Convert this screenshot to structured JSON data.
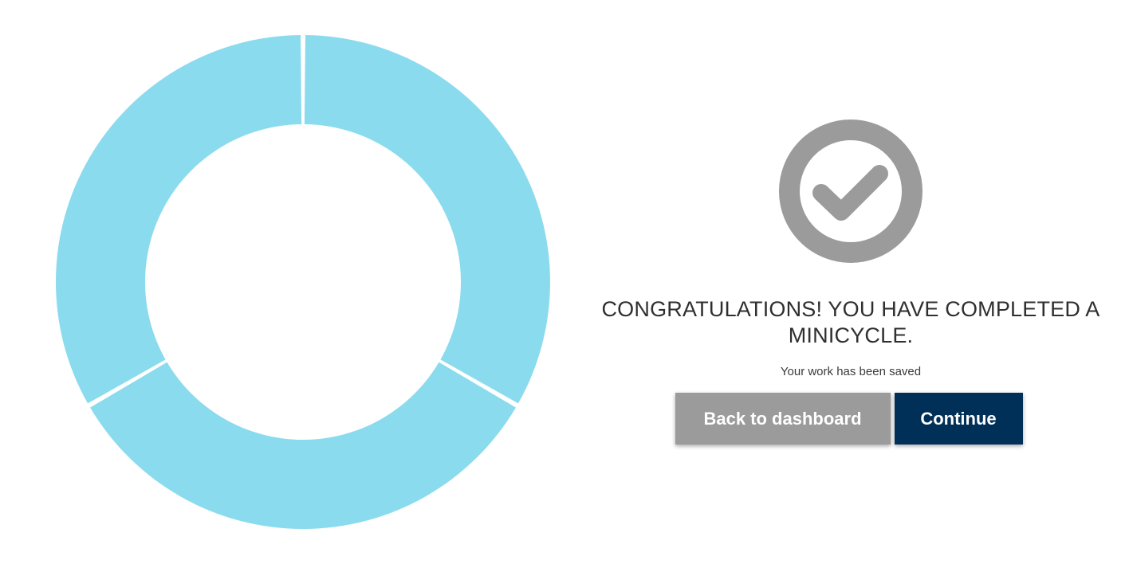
{
  "progress_ring": {
    "segments_total": 3,
    "segments_completed": 3,
    "color": "#8bdbee"
  },
  "completion": {
    "icon": "check-circle-icon",
    "icon_color": "#9b9b9b",
    "title_line1": "CONGRATULATIONS! YOU HAVE COMPLETED A",
    "title_line2": "MINICYCLE.",
    "subtitle": "Your work has been saved"
  },
  "actions": {
    "back_label": "Back to dashboard",
    "continue_label": "Continue",
    "continue_color": "#003057",
    "back_color": "#9b9b9b"
  }
}
